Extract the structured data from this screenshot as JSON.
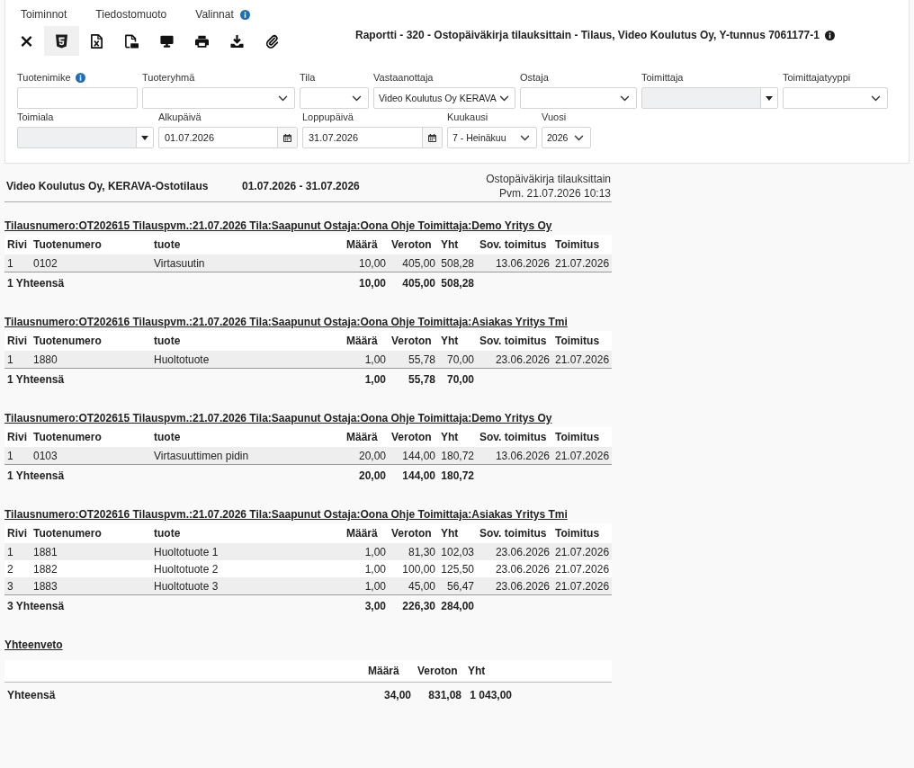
{
  "menu": [
    {
      "label": "Toiminnot"
    },
    {
      "label": "Tiedostomuoto"
    },
    {
      "label": "Valinnat",
      "info": true
    }
  ],
  "toolbar": [
    {
      "kind": "close",
      "selected": false
    },
    {
      "kind": "html",
      "selected": true
    },
    {
      "kind": "excel",
      "selected": false
    },
    {
      "kind": "pdf",
      "selected": false
    },
    {
      "kind": "screen",
      "selected": false
    },
    {
      "kind": "print",
      "selected": false
    },
    {
      "kind": "download",
      "selected": false
    },
    {
      "kind": "attach",
      "selected": false
    }
  ],
  "title": {
    "text": "Raportti - 320 - Ostopäiväkirja tilauksittain - Tilaus, Video Koulutus Oy, Y-tunnus 7061177-1",
    "info": true
  },
  "filters": [
    [
      {
        "label": "Tuotenimike",
        "kind": "text",
        "info": true,
        "disabled": false
      },
      {
        "label": "Tuoteryhmä",
        "kind": "select",
        "disabled": false
      },
      {
        "label": "Tila",
        "kind": "select",
        "disabled": false
      },
      {
        "label": "Vastaanottaja",
        "kind": "select",
        "value": "Video Koulutus Oy KERAVA",
        "disabled": false
      },
      {
        "label": "Ostaja",
        "kind": "select",
        "disabled": false
      },
      {
        "label": "Toimittaja",
        "kind": "combo",
        "disabled": true
      },
      {
        "label": "Toimittajatyyppi",
        "kind": "select",
        "disabled": false
      }
    ],
    [
      {
        "label": "Toimiala",
        "kind": "combo",
        "disabled": true
      },
      {
        "label": "Alkupäivä",
        "kind": "date",
        "value": "01.07.2026",
        "disabled": false
      },
      {
        "label": "Loppupäivä",
        "kind": "date",
        "value": "31.07.2026",
        "disabled": false
      },
      {
        "label": "Kuukausi",
        "kind": "select",
        "value": "7 - Heinäkuu",
        "disabled": false
      },
      {
        "label": "Vuosi",
        "kind": "select",
        "value": "2026",
        "disabled": false
      }
    ]
  ],
  "report": {
    "company": "Video Koulutus Oy, KERAVA-Ostotilaus",
    "period": "01.07.2026 - 31.07.2026",
    "name": "Ostopäiväkirja tilauksittain",
    "printed": "Pvm. 21.07.2026 10:13"
  },
  "orders": [
    {
      "heading": "Tilausnumero:OT202615 Tilauspvm.:21.07.2026 Tila:Saapunut Ostaja:Oona Ohje Toimittaja:Demo Yritys Oy",
      "columns": [
        "Rivi",
        "Tuotenumero",
        "tuote",
        "Määrä",
        "Veroton",
        "Yht",
        "Sov. toimitus",
        "Toimitus"
      ],
      "rows": [
        [
          "1",
          "0102",
          "Virtasuutin",
          "10,00",
          "405,00",
          "508,28",
          "13.06.2026",
          "21.07.2026"
        ]
      ],
      "total": {
        "label": "1 Yhteensä",
        "values": [
          "10,00",
          "405,00",
          "508,28"
        ]
      }
    },
    {
      "heading": "Tilausnumero:OT202616 Tilauspvm.:21.07.2026 Tila:Saapunut Ostaja:Oona Ohje Toimittaja:Asiakas Yritys Tmi",
      "columns": [
        "Rivi",
        "Tuotenumero",
        "tuote",
        "Määrä",
        "Veroton",
        "Yht",
        "Sov. toimitus",
        "Toimitus"
      ],
      "rows": [
        [
          "1",
          "1880",
          "Huoltotuote",
          "1,00",
          "55,78",
          "70,00",
          "23.06.2026",
          "21.07.2026"
        ]
      ],
      "total": {
        "label": "1 Yhteensä",
        "values": [
          "1,00",
          "55,78",
          "70,00"
        ]
      }
    },
    {
      "heading": "Tilausnumero:OT202615 Tilauspvm.:21.07.2026 Tila:Saapunut Ostaja:Oona Ohje Toimittaja:Demo Yritys Oy",
      "columns": [
        "Rivi",
        "Tuotenumero",
        "tuote",
        "Määrä",
        "Veroton",
        "Yht",
        "Sov. toimitus",
        "Toimitus"
      ],
      "rows": [
        [
          "1",
          "0103",
          "Virtasuuttimen pidin",
          "20,00",
          "144,00",
          "180,72",
          "13.06.2026",
          "21.07.2026"
        ]
      ],
      "total": {
        "label": "1 Yhteensä",
        "values": [
          "20,00",
          "144,00",
          "180,72"
        ]
      }
    },
    {
      "heading": "Tilausnumero:OT202616 Tilauspvm.:21.07.2026 Tila:Saapunut Ostaja:Oona Ohje Toimittaja:Asiakas Yritys Tmi",
      "columns": [
        "Rivi",
        "Tuotenumero",
        "tuote",
        "Määrä",
        "Veroton",
        "Yht",
        "Sov. toimitus",
        "Toimitus"
      ],
      "rows": [
        [
          "1",
          "1881",
          "Huoltotuote 1",
          "1,00",
          "81,30",
          "102,03",
          "23.06.2026",
          "21.07.2026"
        ],
        [
          "2",
          "1882",
          "Huoltotuote 2",
          "1,00",
          "100,00",
          "125,50",
          "23.06.2026",
          "21.07.2026"
        ],
        [
          "3",
          "1883",
          "Huoltotuote 3",
          "1,00",
          "45,00",
          "56,47",
          "23.06.2026",
          "21.07.2026"
        ]
      ],
      "total": {
        "label": "3 Yhteensä",
        "values": [
          "3,00",
          "226,30",
          "284,00"
        ]
      }
    }
  ],
  "summary": {
    "title": "Yhteenveto",
    "columns": [
      "Määrä",
      "Veroton",
      "Yht"
    ],
    "label": "Yhteensä",
    "values": [
      "34,00",
      "831,08",
      "1 043,00"
    ]
  }
}
